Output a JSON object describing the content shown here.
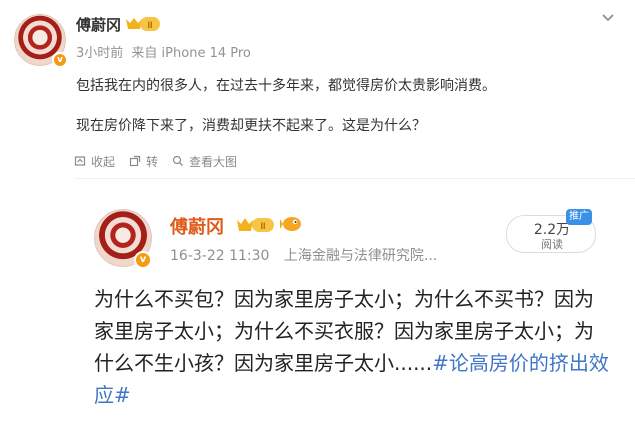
{
  "post": {
    "username": "傅蔚冈",
    "time": "3小时前",
    "source": "来自 iPhone 14 Pro",
    "paragraphs": [
      "包括我在内的很多人，在过去十多年来，都觉得房价太贵影响消费。",
      "现在房价降下来了，消费却更扶不起来了。这是为什么？"
    ]
  },
  "actions": [
    {
      "label": "收起",
      "icon": "collapse-icon"
    },
    {
      "label": "转",
      "icon": "expand-icon"
    },
    {
      "label": "查看大图",
      "icon": "zoom-icon"
    }
  ],
  "embed": {
    "username": "傅蔚冈",
    "date": "16-3-22 11:30",
    "source": "上海金融与法律研究院...",
    "reads_value": "2.2万",
    "reads_label": "阅读",
    "promo": "推广",
    "text_main": "为什么不买包？因为家里房子太小；为什么不买书？因为家里房子太小；为什么不买衣服？因为家里房子太小；为什么不生小孩？因为家里房子太小......",
    "hashtag": "#论高房价的挤出效应#"
  },
  "colors": {
    "name_orange": "#e05a1a",
    "hashtag_blue": "#3f76c8",
    "badge_orange": "#f59a14",
    "promo_blue": "#3a8fe6"
  }
}
